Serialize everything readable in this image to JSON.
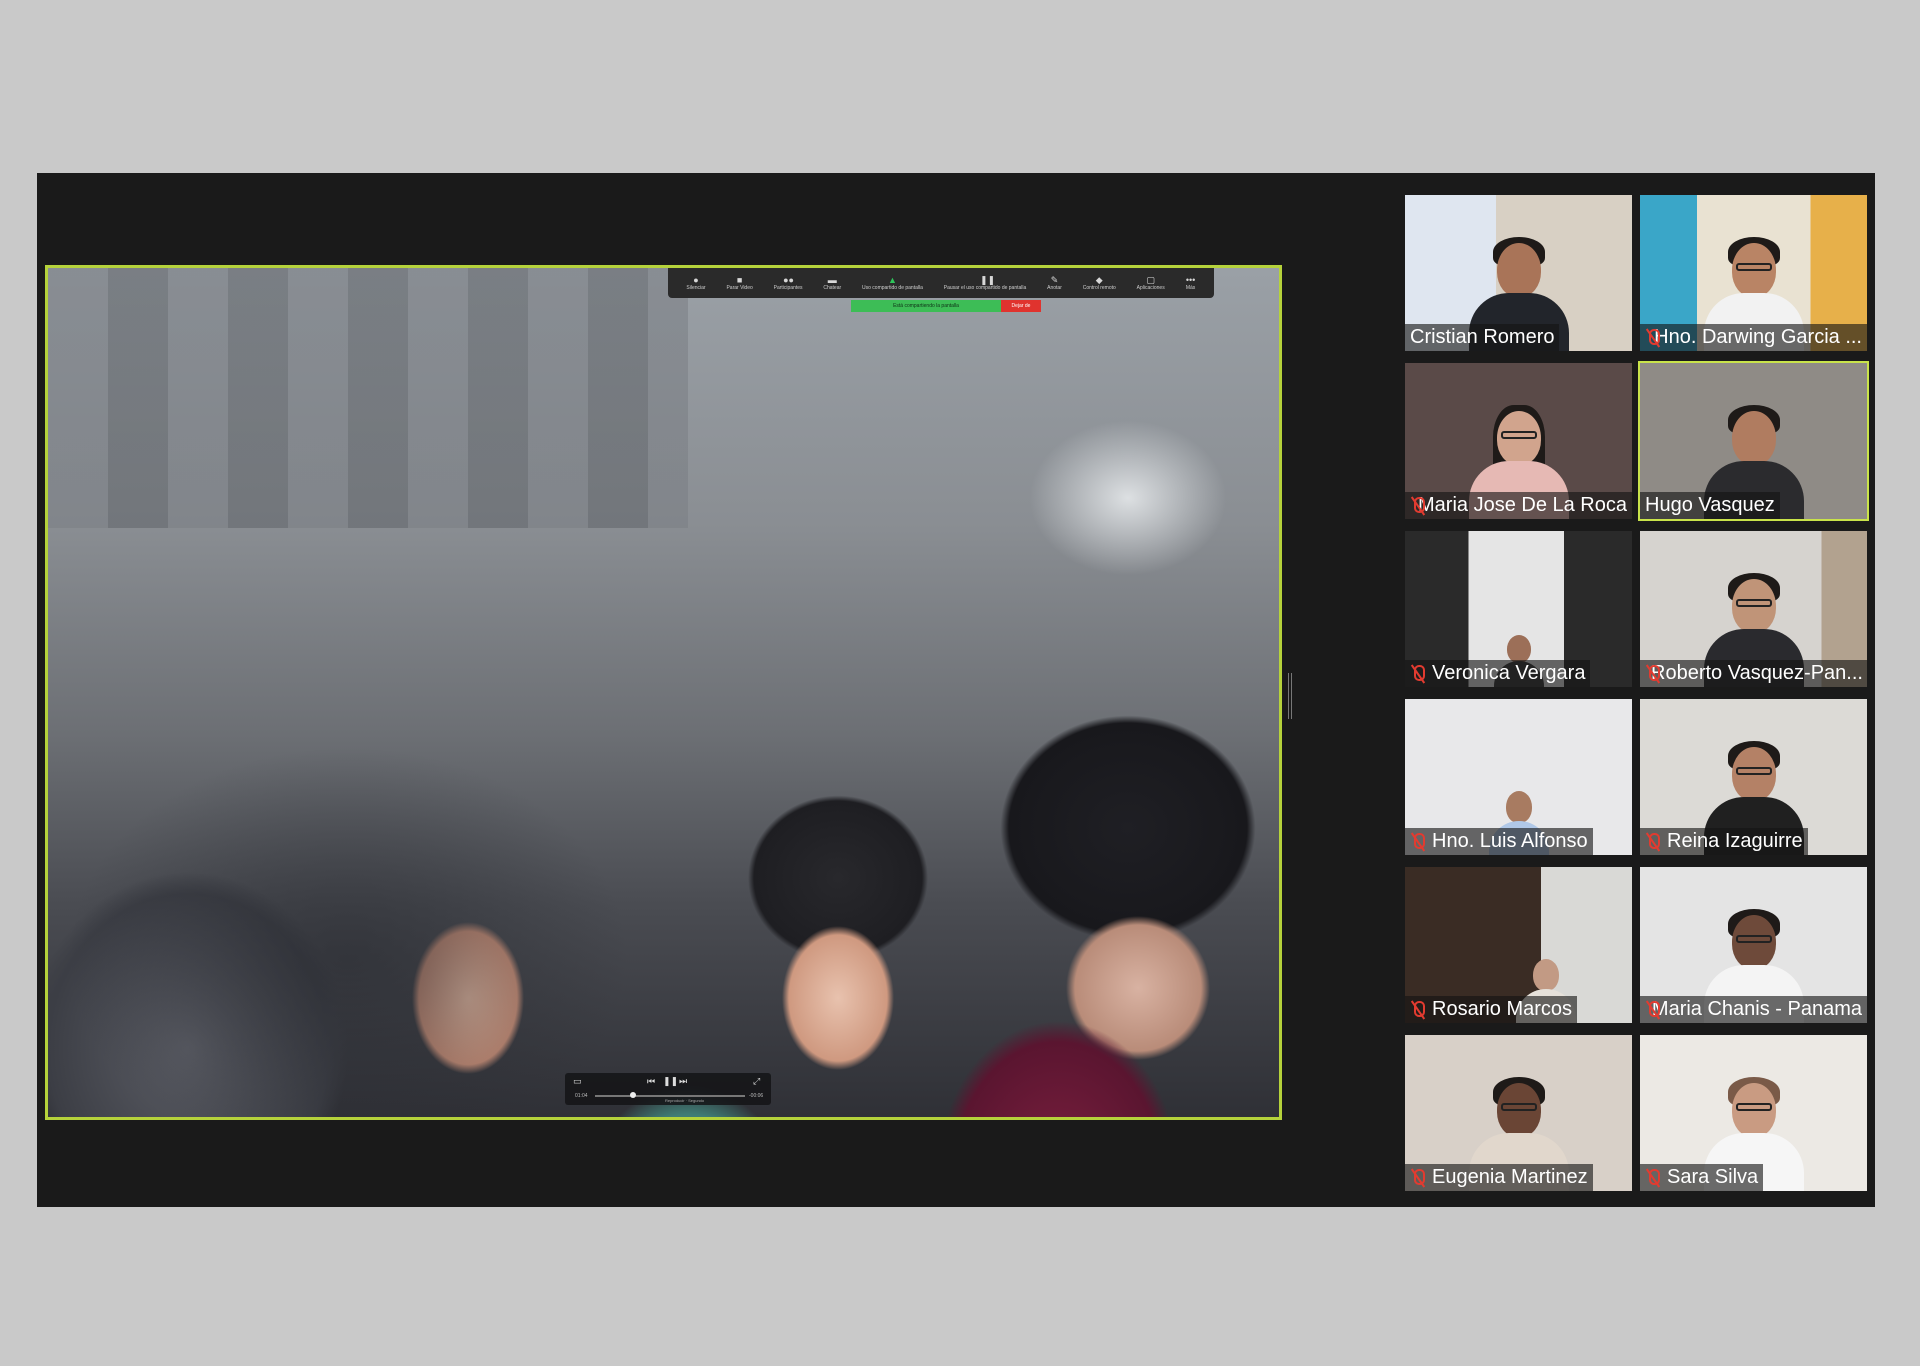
{
  "window": {
    "background": "#1a1a1a"
  },
  "toolbar": {
    "buttons": [
      {
        "label": "Silenciar",
        "icon": "microphone-icon"
      },
      {
        "label": "Parar Video",
        "icon": "video-camera-icon"
      },
      {
        "label": "Participantes",
        "icon": "participants-icon"
      },
      {
        "label": "Chatear",
        "icon": "chat-icon"
      },
      {
        "label": "Uso compartido de pantalla",
        "icon": "share-screen-icon"
      },
      {
        "label": "Pausar el uso compartido de pantalla",
        "icon": "pause-icon"
      },
      {
        "label": "Anotar",
        "icon": "pencil-icon"
      },
      {
        "label": "Control remoto",
        "icon": "remote-control-icon"
      },
      {
        "label": "Aplicaciones",
        "icon": "apps-icon"
      },
      {
        "label": "Más",
        "icon": "more-icon"
      }
    ],
    "share_status": "Está compartiendo la pantalla",
    "stop_share": "Dejar de"
  },
  "video_player": {
    "elapsed": "01:04",
    "remaining": "-00:06",
    "label": "Reproducir · Segundo",
    "progress": 0.25
  },
  "participants": [
    {
      "name": "Cristian Romero",
      "muted": false
    },
    {
      "name": "Hno. Darwing Garcia ...",
      "muted": true
    },
    {
      "name": "Maria Jose De La Roca",
      "muted": true
    },
    {
      "name": "Hugo Vasquez",
      "muted": false,
      "speaking": true
    },
    {
      "name": "Veronica Vergara",
      "muted": true
    },
    {
      "name": "Roberto Vasquez-Pan...",
      "muted": true
    },
    {
      "name": "Hno. Luis Alfonso",
      "muted": true
    },
    {
      "name": "Reina Izaguirre",
      "muted": true
    },
    {
      "name": "Rosario Marcos",
      "muted": true
    },
    {
      "name": "Maria Chanis - Panama",
      "muted": true
    },
    {
      "name": "Eugenia Martinez",
      "muted": true
    },
    {
      "name": "Sara Silva",
      "muted": true
    }
  ],
  "colors": {
    "active_speaker": "#c9e34a",
    "share_border": "#b5d23b",
    "mute_red": "#e23b30"
  }
}
